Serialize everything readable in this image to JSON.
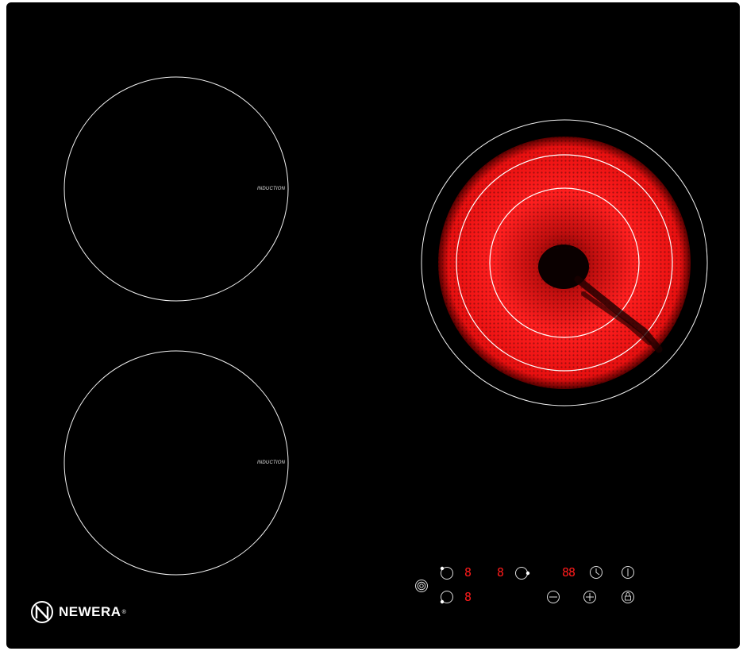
{
  "brand": {
    "name": "NEWERA",
    "registered": "®",
    "logo_letter": "N"
  },
  "zones": {
    "top_left": {
      "label": "INDUCTION"
    },
    "bottom_left": {
      "label": "INDUCTION"
    },
    "right": {
      "state": "radiant-heating"
    }
  },
  "controls": {
    "display_front_left": "8",
    "display_rear_left": "8",
    "display_right": "8",
    "display_timer": "88",
    "icons": [
      "zone-select-icon",
      "timer-clock-icon",
      "power-icon",
      "minus-icon",
      "plus-icon",
      "lock-icon",
      "boost-icon"
    ]
  },
  "colors": {
    "glass": "#000000",
    "heat": "#ff1a1a",
    "display": "#ff1b1b",
    "line": "#ffffff"
  }
}
